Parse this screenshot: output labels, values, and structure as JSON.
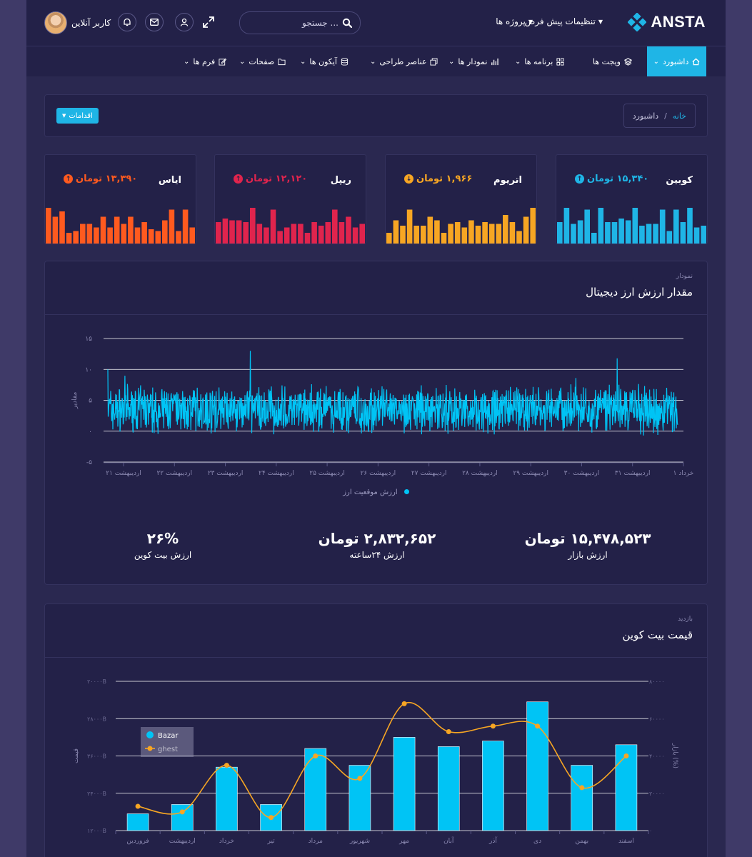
{
  "topbar": {
    "logo": "ANSTA",
    "menu_settings": "تنظیمات پیش فرض",
    "menu_projects": "پروژه ها",
    "search_placeholder": "جستجو ...",
    "user_name": "کاربر آنلاین"
  },
  "nav": {
    "items": [
      {
        "label": "داشبورد",
        "icon": "home-icon"
      },
      {
        "label": "ویجت ها",
        "icon": "layers-icon"
      },
      {
        "label": "برنامه ها",
        "icon": "grid-icon"
      },
      {
        "label": "نمودار ها",
        "icon": "bar-chart-icon"
      },
      {
        "label": "عناصر طراحی",
        "icon": "copy-icon"
      },
      {
        "label": "آیکون ها",
        "icon": "database-icon"
      },
      {
        "label": "صفحات",
        "icon": "folder-icon"
      },
      {
        "label": "فرم ها",
        "icon": "edit-icon"
      }
    ]
  },
  "breadcrumb": {
    "home": "خانه",
    "separator": "/",
    "current": "داشبورد"
  },
  "actions_button": "اقدامات",
  "cards": [
    {
      "name": "کوبین",
      "value": "۱۵,۳۴۰ تومان",
      "trend": "up",
      "color": "#1fb5e6",
      "bars": [
        0.6,
        1.0,
        0.55,
        0.65,
        0.95,
        0.3,
        1.0,
        0.6,
        0.6,
        0.7,
        0.65,
        1.0,
        0.5,
        0.55,
        0.55,
        0.95,
        0.35,
        0.95,
        0.6,
        1.0,
        0.45,
        0.5
      ]
    },
    {
      "name": "اتریوم",
      "value": "۱,۹۶۶ تومان",
      "trend": "down",
      "color": "#f7a623",
      "bars": [
        0.3,
        0.65,
        0.5,
        0.95,
        0.5,
        0.5,
        0.75,
        0.65,
        0.3,
        0.55,
        0.6,
        0.45,
        0.65,
        0.5,
        0.6,
        0.55,
        0.55,
        0.8,
        0.6,
        0.35,
        0.75,
        1.0
      ]
    },
    {
      "name": "ریپل",
      "value": "۱۲,۱۲۰ تومان",
      "trend": "up",
      "color": "#e0244d",
      "bars": [
        0.6,
        0.7,
        0.65,
        0.65,
        0.6,
        1.0,
        0.55,
        0.45,
        0.95,
        0.35,
        0.45,
        0.55,
        0.55,
        0.3,
        0.6,
        0.5,
        0.6,
        0.95,
        0.6,
        0.75,
        0.45,
        0.55
      ]
    },
    {
      "name": "ایاس",
      "value": "۱۳,۳۹۰ تومان",
      "trend": "up",
      "color": "#ff5a1f",
      "bars": [
        1.0,
        0.75,
        0.9,
        0.3,
        0.35,
        0.55,
        0.55,
        0.45,
        0.75,
        0.45,
        0.75,
        0.55,
        0.75,
        0.45,
        0.6,
        0.4,
        0.35,
        0.65,
        0.95,
        0.35,
        0.95,
        0.45
      ]
    }
  ],
  "panel1": {
    "small_title": "نمودار",
    "title": "مقدار ارزش ارز دیجیتال",
    "legend": "ارزش موقعیت ارز",
    "ylabel": "مقادیر",
    "stats": [
      {
        "value": "۱۵,۴۷۸,۵۲۳ تومان",
        "label": "ارزش بازار"
      },
      {
        "value": "۲,۸۳۲,۶۵۲ تومان",
        "label": "ارزش ۲۴ساعته"
      },
      {
        "value": "۲۶%",
        "label": "ارزش بیت کوین"
      }
    ]
  },
  "panel2": {
    "small_title": "بازدید",
    "title": "قیمت بیت کوین"
  },
  "chart_data": [
    {
      "type": "area",
      "ylim": [
        -5,
        15
      ],
      "yticks": [
        "۱۵",
        "۱۰",
        "۵",
        "۰",
        "-۵"
      ],
      "xticks": [
        "اردیبهشت ۲۱",
        "اردیبهشت ۲۲",
        "اردیبهشت ۲۳",
        "اردیبهشت ۲۴",
        "اردیبهشت ۲۵",
        "اردیبهشت ۲۶",
        "اردیبهشت ۲۷",
        "اردیبهشت ۲۸",
        "اردیبهشت ۲۹",
        "اردیبهشت ۳۰",
        "اردیبهشت ۳۱",
        "خرداد ۱"
      ],
      "series": [
        {
          "name": "ارزش موقعیت ارز",
          "color": "#00c4f5",
          "approx_mean": 3.5,
          "approx_range": [
            -1.5,
            13
          ]
        }
      ],
      "ylabel": "مقادیر"
    },
    {
      "type": "bar",
      "categories": [
        "فروردین",
        "اردیبهشت",
        "خرداد",
        "تیر",
        "مرداد",
        "شهریور",
        "مهر",
        "آبان",
        "آذر",
        "دی",
        "بهمن",
        "اسفند"
      ],
      "series": [
        {
          "name": "Bazar",
          "type": "bar",
          "color": "#00c4f5",
          "axis": "left",
          "values": [
            0.9,
            1.4,
            3.4,
            1.4,
            4.4,
            3.5,
            5.0,
            4.5,
            4.8,
            6.9,
            3.5,
            4.6
          ]
        },
        {
          "name": "ghest",
          "type": "line",
          "color": "#f7a623",
          "axis": "right",
          "values": [
            1300,
            1000,
            3500,
            700,
            4000,
            2800,
            6800,
            5300,
            5600,
            5600,
            2300,
            4000
          ]
        }
      ],
      "left_ticks": [
        "۲۰۰۰۰B",
        "۲۸۰۰۰B",
        "۳۶۰۰۰B",
        "۲۴۰۰۰B",
        "۱۲۰۰۰B"
      ],
      "right_ticks": [
        "۸۰۰۰۰",
        "۶۰۰۰۰",
        "۴۰۰۰۰",
        "۲۰۰۰۰",
        "۰"
      ],
      "right_lim": [
        0,
        8000
      ],
      "left_lim": [
        0,
        8
      ],
      "ylabel_left": "قیمت",
      "ylabel_right": "بازار (%)"
    }
  ]
}
